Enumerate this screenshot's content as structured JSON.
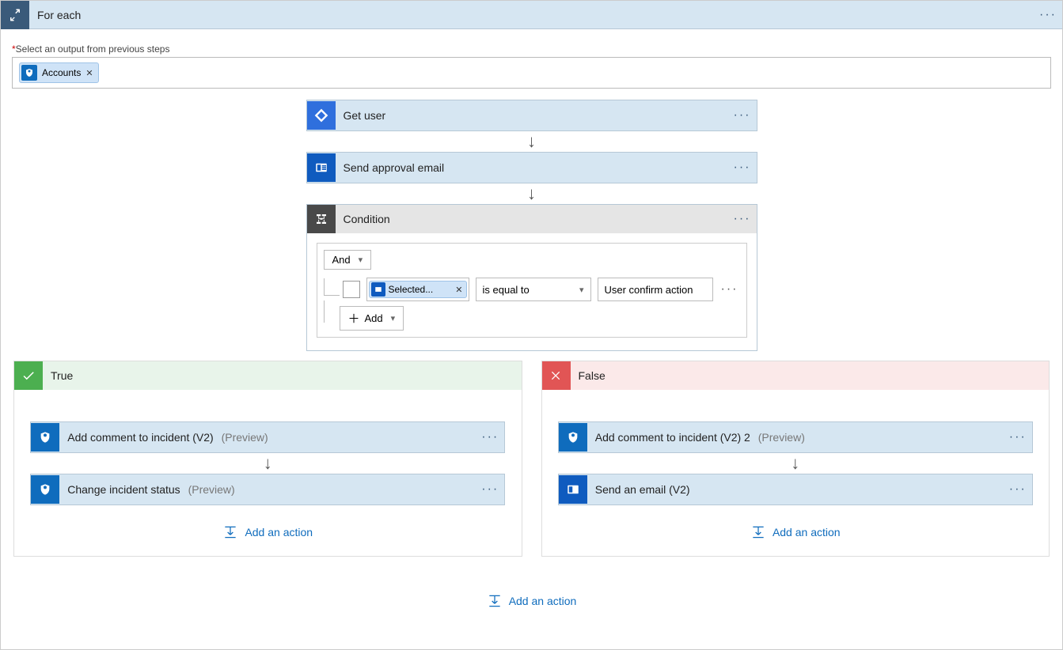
{
  "foreach": {
    "title": "For each"
  },
  "input": {
    "label": "Select an output from previous steps",
    "token": "Accounts"
  },
  "steps": {
    "getUser": "Get user",
    "sendApproval": "Send approval email"
  },
  "condition": {
    "title": "Condition",
    "and": "And",
    "lhsToken": "Selected...",
    "operator": "is equal to",
    "rhs": "User confirm action",
    "addRow": "Add"
  },
  "branches": {
    "trueLabel": "True",
    "falseLabel": "False",
    "trueSteps": {
      "addComment": "Add comment to incident (V2)",
      "addCommentPreview": "(Preview)",
      "changeStatus": "Change incident status",
      "changeStatusPreview": "(Preview)"
    },
    "falseSteps": {
      "addComment": "Add comment to incident (V2) 2",
      "addCommentPreview": "(Preview)",
      "sendEmail": "Send an email (V2)"
    },
    "addAction": "Add an action"
  }
}
